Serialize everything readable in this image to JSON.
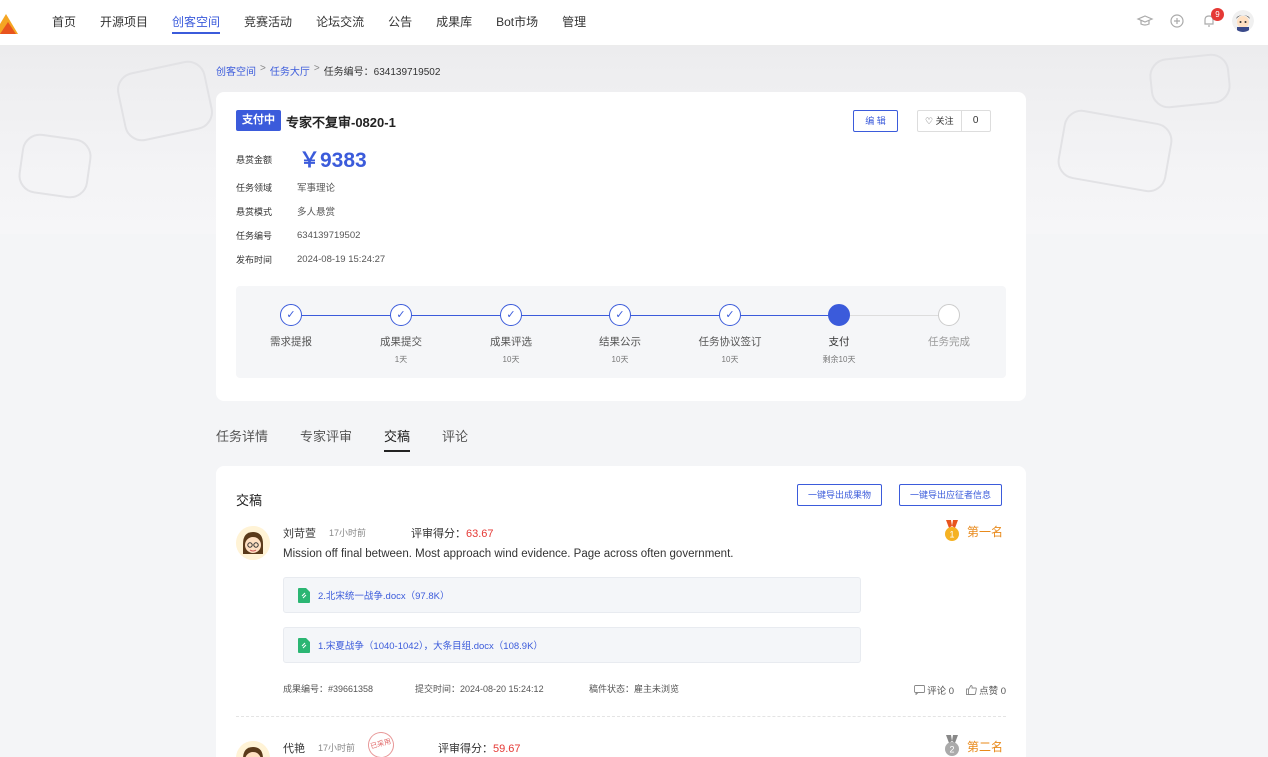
{
  "nav": {
    "items": [
      "首页",
      "开源项目",
      "创客空间",
      "竞赛活动",
      "论坛交流",
      "公告",
      "成果库",
      "Bot市场",
      "管理"
    ],
    "active_index": 2,
    "notification_count": "9",
    "icons": [
      "graduation-cap-icon",
      "plus-circle-icon",
      "bell-icon"
    ]
  },
  "breadcrumb": {
    "items": [
      "创客空间",
      "任务大厅"
    ],
    "sep": ">",
    "current": "任务编号：634139719502"
  },
  "task": {
    "status": "支付中",
    "title": "专家不复审-0820-1",
    "edit_label": "编 辑",
    "follow_label": "关注",
    "follow_count": "0",
    "reward_label": "悬赏金额",
    "reward_amount": "￥9383",
    "field_label": "任务领域",
    "field_value": "军事理论",
    "mode_label": "悬赏模式",
    "mode_value": "多人悬赏",
    "id_label": "任务编号",
    "id_value": "634139719502",
    "time_label": "发布时间",
    "time_value": "2024-08-19 15:24:27"
  },
  "progress": {
    "steps": [
      {
        "name": "需求提报",
        "duration": "",
        "state": "done"
      },
      {
        "name": "成果提交",
        "duration": "1天",
        "state": "done"
      },
      {
        "name": "成果评选",
        "duration": "10天",
        "state": "done"
      },
      {
        "name": "结果公示",
        "duration": "10天",
        "state": "done"
      },
      {
        "name": "任务协议签订",
        "duration": "10天",
        "state": "done"
      },
      {
        "name": "支付",
        "duration": "剩余10天",
        "state": "current"
      },
      {
        "name": "任务完成",
        "duration": "",
        "state": "pending"
      }
    ],
    "check_glyph": "✓"
  },
  "tabs": {
    "items": [
      "任务详情",
      "专家评审",
      "交稿",
      "评论"
    ],
    "active_index": 2
  },
  "submissions": {
    "title": "交稿",
    "export_results_label": "一键导出成果物",
    "export_applicants_label": "一键导出应征者信息",
    "score_label": "评审得分：",
    "items": [
      {
        "name": "刘苛萱",
        "time": "17小时前",
        "score": "63.67",
        "rank": "第一名",
        "rank_num": "1",
        "text": "Mission off final between. Most approach wind evidence. Page across often government.",
        "files": [
          "2.北宋统一战争.docx（97.8K）",
          "1.宋夏战争（1040-1042），大条目组.docx（108.9K）"
        ],
        "result_no": "成果编号：#39661358",
        "submit_time": "提交时间：2024-08-20 15:24:12",
        "status": "稿件状态：雇主未浏览",
        "comments": "评论 0",
        "likes": "点赞 0"
      },
      {
        "name": "代艳",
        "time": "17小时前",
        "stamp": "已采用",
        "score": "59.67",
        "rank": "第二名",
        "rank_num": "2"
      }
    ]
  }
}
